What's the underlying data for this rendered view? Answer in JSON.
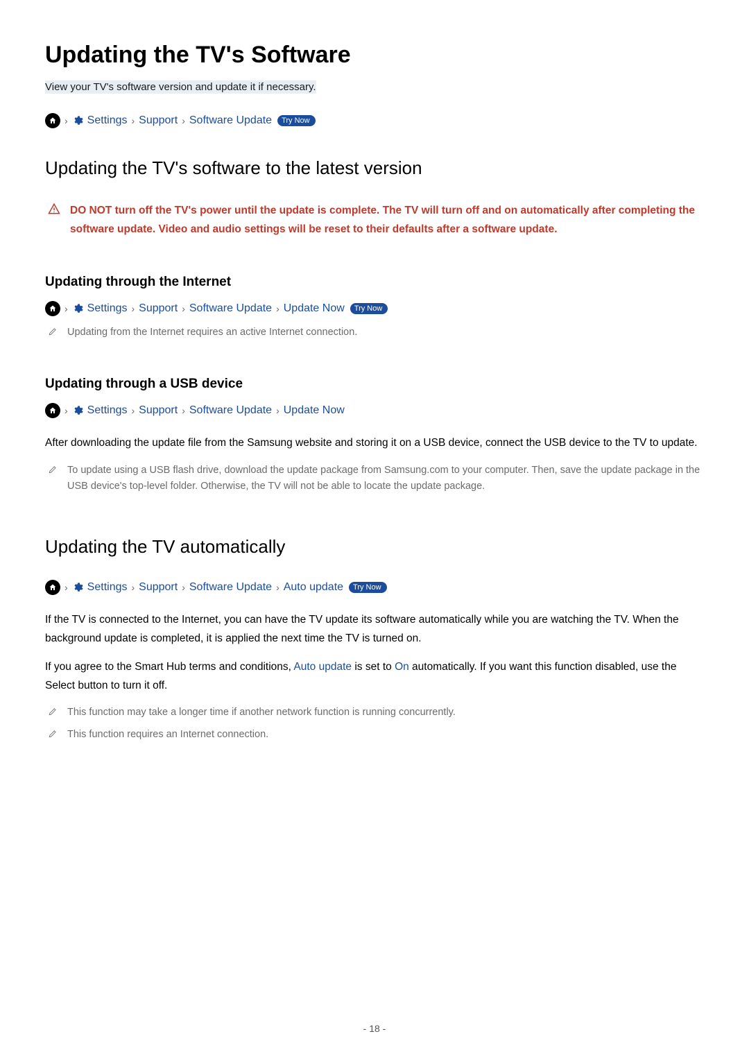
{
  "title": "Updating the TV's Software",
  "subtitle": "View your TV's software version and update it if necessary.",
  "tryNowLabel": "Try Now",
  "breadcrumbs": {
    "main": {
      "settings": "Settings",
      "support": "Support",
      "softwareUpdate": "Software Update"
    },
    "internet": {
      "settings": "Settings",
      "support": "Support",
      "softwareUpdate": "Software Update",
      "updateNow": "Update Now"
    },
    "usb": {
      "settings": "Settings",
      "support": "Support",
      "softwareUpdate": "Software Update",
      "updateNow": "Update Now"
    },
    "auto": {
      "settings": "Settings",
      "support": "Support",
      "softwareUpdate": "Software Update",
      "autoUpdate": "Auto update"
    }
  },
  "section1": {
    "heading": "Updating the TV's software to the latest version",
    "warning": "DO NOT turn off the TV's power until the update is complete. The TV will turn off and on automatically after completing the software update. Video and audio settings will be reset to their defaults after a software update.",
    "internetHeading": "Updating through the Internet",
    "internetNote": "Updating from the Internet requires an active Internet connection.",
    "usbHeading": "Updating through a USB device",
    "usbBody": "After downloading the update file from the Samsung website and storing it on a USB device, connect the USB device to the TV to update.",
    "usbNote": "To update using a USB flash drive, download the update package from Samsung.com to your computer. Then, save the update package in the USB device's top-level folder. Otherwise, the TV will not be able to locate the update package."
  },
  "section2": {
    "heading": "Updating the TV automatically",
    "body1": "If the TV is connected to the Internet, you can have the TV update its software automatically while you are watching the TV. When the background update is completed, it is applied the next time the TV is turned on.",
    "body2Pre": "If you agree to the Smart Hub terms and conditions, ",
    "body2Link1": "Auto update",
    "body2Mid": " is set to ",
    "body2Link2": "On",
    "body2Post": " automatically. If you want this function disabled, use the Select button to turn it off.",
    "note1": "This function may take a longer time if another network function is running concurrently.",
    "note2": "This function requires an Internet connection."
  },
  "pageNumber": "- 18 -"
}
